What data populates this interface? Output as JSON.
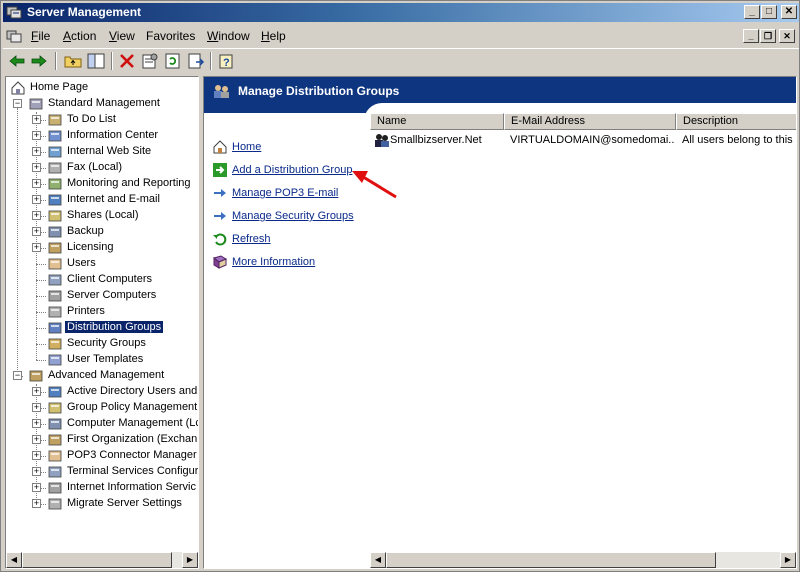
{
  "window": {
    "title": "Server Management"
  },
  "menu": [
    {
      "label": "File",
      "underline": "F",
      "rest": "ile"
    },
    {
      "label": "Action",
      "underline": "A",
      "rest": "ction"
    },
    {
      "label": "View",
      "underline": "V",
      "rest": "iew"
    },
    {
      "label": "Favorites",
      "underline": "",
      "rest": "Favorites"
    },
    {
      "label": "Window",
      "underline": "W",
      "rest": "indow"
    },
    {
      "label": "Help",
      "underline": "H",
      "rest": "elp"
    }
  ],
  "toolbar": {
    "icons": [
      "back-icon",
      "forward-icon",
      "up-folder-icon",
      "show-hide-tree-icon",
      "delete-icon",
      "properties-icon",
      "refresh-icon",
      "export-list-icon",
      "help-icon"
    ]
  },
  "tree": {
    "root": "Home Page",
    "standard": {
      "label": "Standard Management",
      "items": [
        {
          "label": "To Do List",
          "expandable": true,
          "icon": "todo-list-icon"
        },
        {
          "label": "Information Center",
          "expandable": true,
          "icon": "info-center-icon"
        },
        {
          "label": "Internal Web Site",
          "expandable": true,
          "icon": "web-site-icon"
        },
        {
          "label": "Fax (Local)",
          "expandable": true,
          "icon": "fax-icon"
        },
        {
          "label": "Monitoring and Reporting",
          "expandable": true,
          "icon": "monitoring-icon"
        },
        {
          "label": "Internet and E-mail",
          "expandable": true,
          "icon": "internet-email-icon"
        },
        {
          "label": "Shares (Local)",
          "expandable": true,
          "icon": "shares-icon"
        },
        {
          "label": "Backup",
          "expandable": true,
          "icon": "backup-icon"
        },
        {
          "label": "Licensing",
          "expandable": true,
          "icon": "licensing-icon"
        },
        {
          "label": "Users",
          "expandable": false,
          "icon": "users-icon"
        },
        {
          "label": "Client Computers",
          "expandable": false,
          "icon": "client-computers-icon"
        },
        {
          "label": "Server Computers",
          "expandable": false,
          "icon": "server-computers-icon"
        },
        {
          "label": "Printers",
          "expandable": false,
          "icon": "printers-icon"
        },
        {
          "label": "Distribution Groups",
          "expandable": false,
          "icon": "distribution-groups-icon",
          "selected": true
        },
        {
          "label": "Security Groups",
          "expandable": false,
          "icon": "security-groups-icon"
        },
        {
          "label": "User Templates",
          "expandable": false,
          "icon": "user-templates-icon"
        }
      ]
    },
    "advanced": {
      "label": "Advanced Management",
      "items": [
        {
          "label": "Active Directory Users and",
          "icon": "active-directory-icon"
        },
        {
          "label": "Group Policy Management",
          "icon": "group-policy-icon"
        },
        {
          "label": "Computer Management (Lc",
          "icon": "computer-management-icon"
        },
        {
          "label": "First Organization (Exchan",
          "icon": "exchange-icon"
        },
        {
          "label": "POP3 Connector Manager",
          "icon": "pop3-connector-icon"
        },
        {
          "label": "Terminal Services Configur",
          "icon": "terminal-services-icon"
        },
        {
          "label": "Internet Information Servic",
          "icon": "iis-icon"
        },
        {
          "label": "Migrate Server Settings",
          "icon": "migrate-icon"
        }
      ]
    }
  },
  "content": {
    "title": "Manage Distribution Groups",
    "tasks": [
      {
        "label": "Home",
        "icon": "home-icon"
      },
      {
        "label": "Add a Distribution Group",
        "icon": "add-arrow-icon"
      },
      {
        "label": "Manage POP3 E-mail",
        "icon": "blue-arrow-icon"
      },
      {
        "label": "Manage Security Groups",
        "icon": "blue-arrow-icon"
      },
      {
        "label": "Refresh",
        "icon": "refresh-icon"
      },
      {
        "label": "More Information",
        "icon": "book-icon"
      }
    ],
    "list": {
      "columns": [
        "Name",
        "E-Mail Address",
        "Description"
      ],
      "rows": [
        {
          "name": "Smallbizserver.Net",
          "email": "VIRTUALDOMAIN@somedomai...",
          "description": "All users belong to this d"
        }
      ]
    }
  },
  "colors": {
    "titlebar": "#0a246a",
    "banner": "#0e3580",
    "link": "#0a2a8a",
    "selection": "#0a246a",
    "annotation_arrow": "#e01010"
  }
}
